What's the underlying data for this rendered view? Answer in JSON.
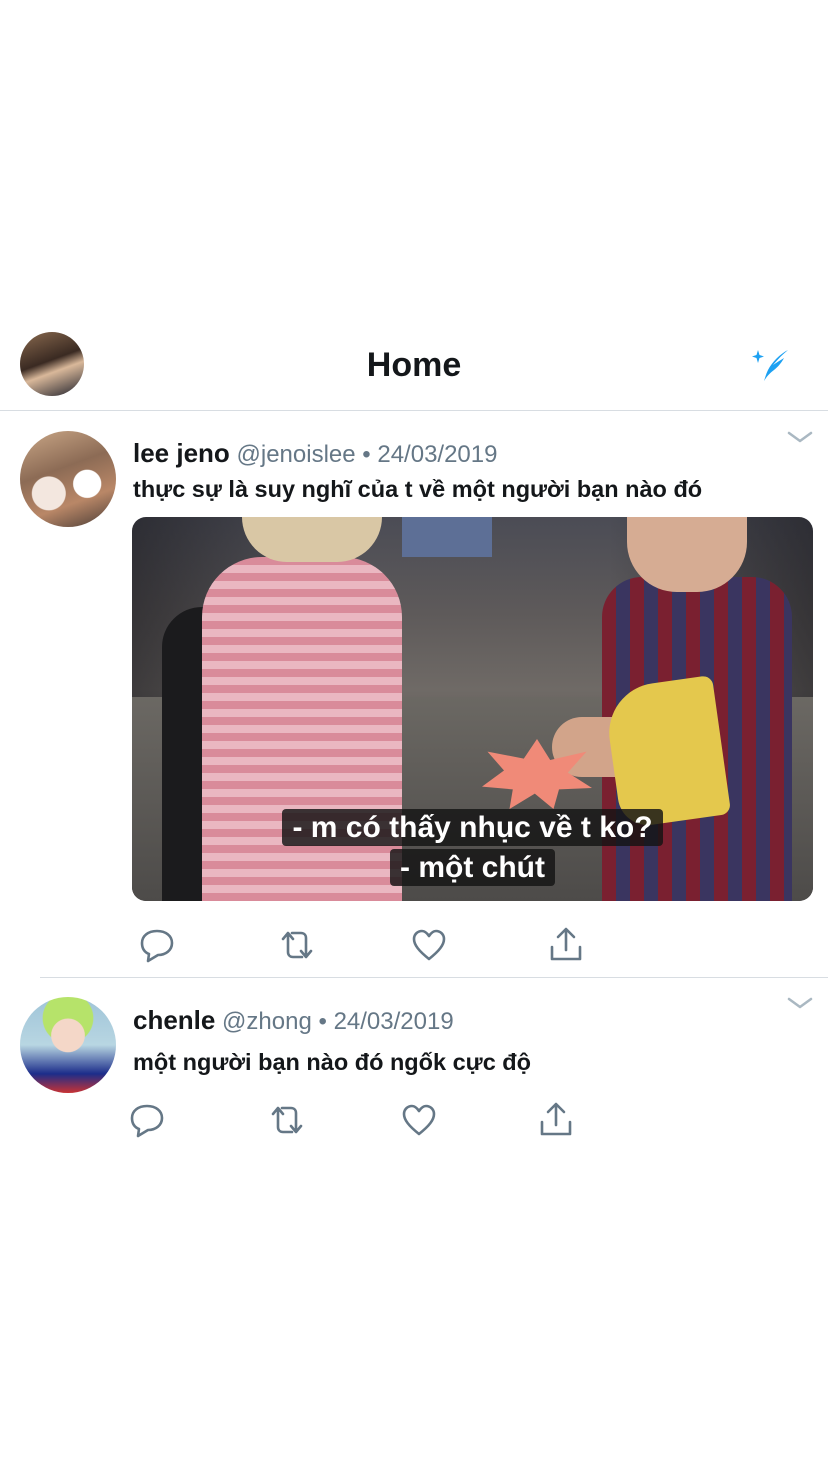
{
  "header": {
    "title": "Home",
    "avatar_icon": "profile-avatar",
    "compose_icon": "sparkle-icon"
  },
  "tweets": [
    {
      "name": "lee jeno",
      "handle": "@jenoislee",
      "date": "24/03/2019",
      "text": "thực sự là suy nghĩ của t về một người bạn nào đó",
      "media": {
        "subtitle_line1": "- m có thấy nhục về t ko?",
        "subtitle_line2": "- một chút"
      }
    },
    {
      "name": "chenle",
      "handle": "@zhong",
      "date": "24/03/2019",
      "text": "một người bạn nào đó ngốk cực độ"
    }
  ],
  "separator": "•",
  "colors": {
    "accent": "#1da1f2",
    "text": "#14171a",
    "secondary": "#657786",
    "border": "#d8dde2"
  }
}
